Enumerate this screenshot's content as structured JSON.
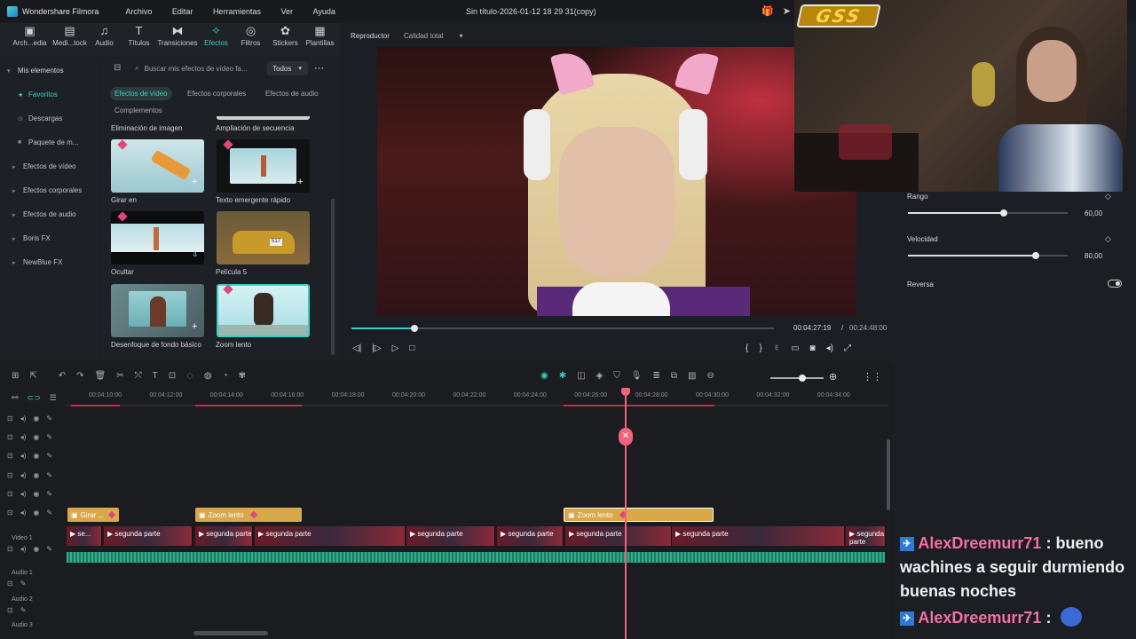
{
  "app": {
    "title": "Wondershare Filmora",
    "window_title": "Sin título-2026-01-12 18 29 31(copy)"
  },
  "menu": [
    "Archivo",
    "Editar",
    "Herramientas",
    "Ver",
    "Ayuda"
  ],
  "toolbar": [
    {
      "label": "Arch...edia",
      "icon": "media-icon"
    },
    {
      "label": "Medi...tock",
      "icon": "stock-icon"
    },
    {
      "label": "Audio",
      "icon": "music-icon"
    },
    {
      "label": "Títulos",
      "icon": "text-icon"
    },
    {
      "label": "Transiciones",
      "icon": "transition-icon"
    },
    {
      "label": "Efectos",
      "icon": "effects-icon",
      "active": true
    },
    {
      "label": "Filtros",
      "icon": "filter-icon"
    },
    {
      "label": "Stickers",
      "icon": "sticker-icon"
    },
    {
      "label": "Plantillas",
      "icon": "template-icon"
    }
  ],
  "leftnav": {
    "items": [
      "Mis elementos",
      "Favoritos",
      "Descargas",
      "Paquete de m...",
      "Efectos de vídeo",
      "Efectos corporales",
      "Efectos de audio",
      "Boris FX",
      "NewBlue FX"
    ]
  },
  "effects": {
    "search_placeholder": "Buscar mis efectos de vídeo fa...",
    "filter": "Todos",
    "tabs": [
      "Efectos de vídeo",
      "Efectos corporales",
      "Efectos de audio",
      "Complementos"
    ],
    "items": [
      "Eliminación de imagen",
      "Ampliación de secuencia",
      "Girar en",
      "Texto emergente rápido",
      "Ocultar",
      "Película 5",
      "Desenfoque de fondo básico",
      "Zoom lento"
    ]
  },
  "player": {
    "label": "Reproductor",
    "quality": "Calidad total",
    "current_time": "00:04:27:19",
    "separator": "/",
    "total_time": "00:24:48:00",
    "progress": 0.15
  },
  "properties": {
    "rango": {
      "label": "Rango",
      "value": "60,00",
      "fraction": 0.6
    },
    "velocidad": {
      "label": "Velocidad",
      "value": "80,00",
      "fraction": 0.8
    },
    "reversa": {
      "label": "Reversa"
    }
  },
  "timeline": {
    "ticks": [
      "00:04:10:00",
      "00:04:12:00",
      "00:04:14:00",
      "00:04:16:00",
      "00:04:18:00",
      "00:04:20:00",
      "00:04:22:00",
      "00:04:24:00",
      "00:04:26:00",
      "00:04:28:00",
      "00:04:30:00",
      "00:04:32:00",
      "00:04:34:00"
    ],
    "effect_clips": [
      "Girar ...",
      "Zoom lento",
      "Zoom lento"
    ],
    "video_clip_label": "segunda parte",
    "video_clip_short": "se...",
    "track_labels": {
      "video1": "Video 1",
      "audio1": "Audio 1",
      "audio2": "Audio 2",
      "audio3": "Audio 3"
    }
  },
  "chat": [
    {
      "user": "AlexDreemurr71",
      "sep": ":",
      "message": "bueno wachines a seguir durmiendo buenas noches"
    },
    {
      "user": "AlexDreemurr71",
      "sep": ":",
      "message": ""
    }
  ],
  "overlay": {
    "logo_text": "GSS"
  },
  "colors": {
    "accent": "#36d1c4",
    "playhead": "#f0637a",
    "effect_clip": "#d9a84a",
    "chat_name": "#f56fa0"
  }
}
